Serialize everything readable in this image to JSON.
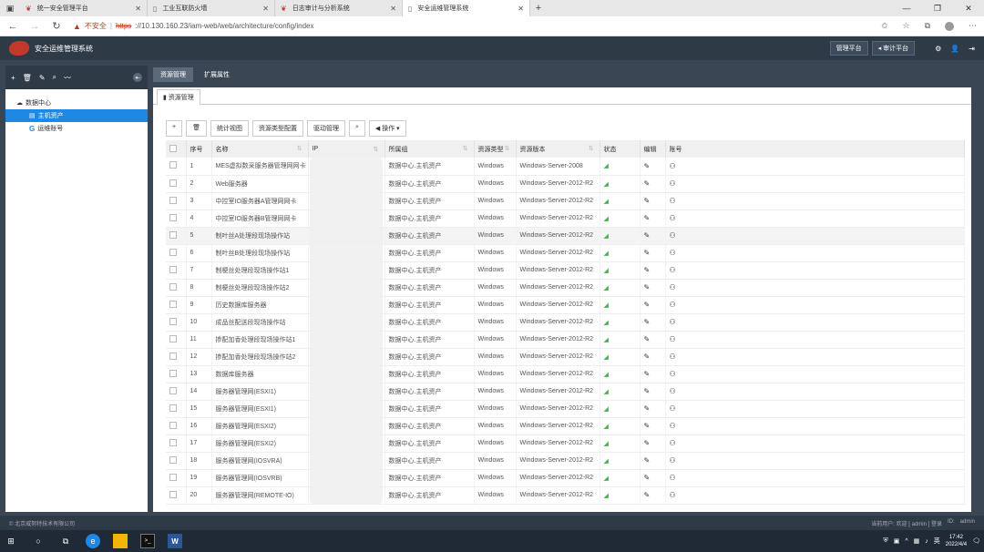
{
  "browser": {
    "tabs": [
      {
        "label": "统一安全管理平台",
        "icon": "huawei-icon"
      },
      {
        "label": "工业互联防火墙",
        "icon": "doc-icon"
      },
      {
        "label": "日志审计与分析系统",
        "icon": "huawei-icon"
      },
      {
        "label": "安全运维管理系统",
        "icon": "doc-icon"
      }
    ],
    "insecure_label": "不安全",
    "url_scheme": "https",
    "url_rest": "://10.130.160.23/iam-web/web/architecture/config/index"
  },
  "app": {
    "title": "安全运维管理系统",
    "header_buttons": [
      "管理平台",
      "◂ 审计平台"
    ]
  },
  "sidebar": {
    "tree": [
      {
        "label": "数据中心",
        "level": 0,
        "icon": "cloud-icon"
      },
      {
        "label": "主机资产",
        "level": 1,
        "icon": "server-icon",
        "selected": true
      },
      {
        "label": "运维账号",
        "level": 1,
        "icon": "g-icon"
      }
    ]
  },
  "main_tabs": [
    "资源管理",
    "扩展属性"
  ],
  "sub_tab": "资源管理",
  "toolbar": {
    "add": "+",
    "delete": "🗑",
    "buttons": [
      "统计视图",
      "资源类型配置",
      "驱动管理"
    ],
    "action": "◀ 操作 ▾"
  },
  "table": {
    "columns": [
      "",
      "序号",
      "名称",
      "IP",
      "所属组",
      "资源类型",
      "资源版本",
      "状态",
      "编辑",
      "账号"
    ],
    "rows": [
      {
        "no": "1",
        "name": "MES虚拟数采服务器管理网网卡",
        "group": "数据中心.主机资产",
        "type": "Windows",
        "version": "Windows-Server-2008"
      },
      {
        "no": "2",
        "name": "Web服务器",
        "group": "数据中心.主机资产",
        "type": "Windows",
        "version": "Windows-Server-2012-R2"
      },
      {
        "no": "3",
        "name": "中控室IO服务器A管理网网卡",
        "group": "数据中心.主机资产",
        "type": "Windows",
        "version": "Windows-Server-2012-R2"
      },
      {
        "no": "4",
        "name": "中控室IO服务器B管理网网卡",
        "group": "数据中心.主机资产",
        "type": "Windows",
        "version": "Windows-Server-2012-R2"
      },
      {
        "no": "5",
        "name": "制叶丝A处理段现场操作站",
        "group": "数据中心.主机资产",
        "type": "Windows",
        "version": "Windows-Server-2012-R2"
      },
      {
        "no": "6",
        "name": "制叶丝B处理段现场操作站",
        "group": "数据中心.主机资产",
        "type": "Windows",
        "version": "Windows-Server-2012-R2"
      },
      {
        "no": "7",
        "name": "制梗丝处理段现场操作站1",
        "group": "数据中心.主机资产",
        "type": "Windows",
        "version": "Windows-Server-2012-R2"
      },
      {
        "no": "8",
        "name": "制梗丝处理段现场操作站2",
        "group": "数据中心.主机资产",
        "type": "Windows",
        "version": "Windows-Server-2012-R2"
      },
      {
        "no": "9",
        "name": "历史数据库服务器",
        "group": "数据中心.主机资产",
        "type": "Windows",
        "version": "Windows-Server-2012-R2"
      },
      {
        "no": "10",
        "name": "成品丝配送段现场操作站",
        "group": "数据中心.主机资产",
        "type": "Windows",
        "version": "Windows-Server-2012-R2"
      },
      {
        "no": "11",
        "name": "掺配加香处理段现场操作站1",
        "group": "数据中心.主机资产",
        "type": "Windows",
        "version": "Windows-Server-2012-R2"
      },
      {
        "no": "12",
        "name": "掺配加香处理段现场操作站2",
        "group": "数据中心.主机资产",
        "type": "Windows",
        "version": "Windows-Server-2012-R2"
      },
      {
        "no": "13",
        "name": "数据库服务器",
        "group": "数据中心.主机资产",
        "type": "Windows",
        "version": "Windows-Server-2012-R2"
      },
      {
        "no": "14",
        "name": "服务器管理网(ESXI1)",
        "group": "数据中心.主机资产",
        "type": "Windows",
        "version": "Windows-Server-2012-R2"
      },
      {
        "no": "15",
        "name": "服务器管理网(ESXI1)",
        "group": "数据中心.主机资产",
        "type": "Windows",
        "version": "Windows-Server-2012-R2"
      },
      {
        "no": "16",
        "name": "服务器管理网(ESXI2)",
        "group": "数据中心.主机资产",
        "type": "Windows",
        "version": "Windows-Server-2012-R2"
      },
      {
        "no": "17",
        "name": "服务器管理网(ESXI2)",
        "group": "数据中心.主机资产",
        "type": "Windows",
        "version": "Windows-Server-2012-R2"
      },
      {
        "no": "18",
        "name": "服务器管理网(IOSVRA)",
        "group": "数据中心.主机资产",
        "type": "Windows",
        "version": "Windows-Server-2012-R2"
      },
      {
        "no": "19",
        "name": "服务器管理网(IOSVRB)",
        "group": "数据中心.主机资产",
        "type": "Windows",
        "version": "Windows-Server-2012-R2"
      },
      {
        "no": "20",
        "name": "服务器管理网(REMOTE-IO)",
        "group": "数据中心.主机资产",
        "type": "Windows",
        "version": "Windows-Server-2012-R2"
      }
    ]
  },
  "footer": {
    "copyright": "© 北京威努特技术有限公司",
    "user_info": "当前用户: 欢迎 [ admin ] 登录",
    "id_label": "ID:",
    "id_value": "admin"
  },
  "taskbar": {
    "time": "17:42",
    "date": "2022/4/4",
    "lang": "英"
  }
}
